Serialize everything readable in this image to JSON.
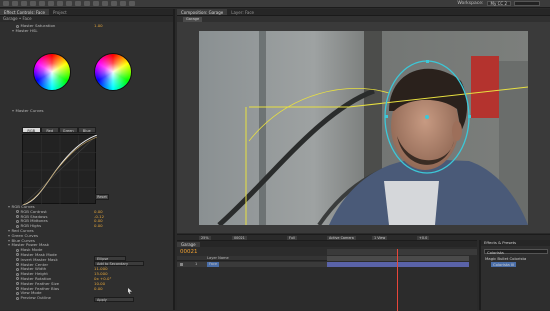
{
  "header": {
    "workspace_label": "Workspace:",
    "workspace_value": "My CC 2"
  },
  "left_panel": {
    "tabs": [
      "Effect Controls: Face",
      "Project"
    ],
    "subheader": "Garage • Face",
    "rows_top": [
      {
        "name": "Master Saturation",
        "value": "1.00"
      },
      {
        "name": "Master HSL",
        "value": ""
      }
    ],
    "master_curves_label": "Master Curves",
    "curve_tabs": [
      "RGB",
      "Red",
      "Green",
      "Blue"
    ],
    "reset_label": "Reset",
    "rows_bottom": [
      {
        "name": "RGB Curves",
        "value": "",
        "indent": 0
      },
      {
        "name": "RGB Contrast",
        "value": "0.00",
        "indent": 1
      },
      {
        "name": "RGB Shadows",
        "value": "-0.12",
        "indent": 1
      },
      {
        "name": "RGB Midtones",
        "value": "0.00",
        "indent": 1
      },
      {
        "name": "RGB Highs",
        "value": "0.00",
        "indent": 1
      },
      {
        "name": "Red Curves",
        "value": "",
        "indent": 0
      },
      {
        "name": "Green Curves",
        "value": "",
        "indent": 0
      },
      {
        "name": "Blue Curves",
        "value": "",
        "indent": 0
      },
      {
        "name": "Master Power Mask",
        "value": "",
        "indent": 0
      },
      {
        "name": "Mask Mode",
        "value": "",
        "indent": 1
      },
      {
        "name": "Master Mask Mode",
        "value": "",
        "indent": 1
      },
      {
        "name": "Invert Master Mask",
        "value": "",
        "indent": 1
      },
      {
        "name": "Master Center",
        "value": "300.0, 211.0",
        "indent": 1
      },
      {
        "name": "Master Width",
        "value": "11.000",
        "indent": 1
      },
      {
        "name": "Master Height",
        "value": "15.000",
        "indent": 1
      },
      {
        "name": "Master Rotation",
        "value": "0x +0.0°",
        "indent": 1
      },
      {
        "name": "Master Feather Size",
        "value": "10.00",
        "indent": 1
      },
      {
        "name": "Master Feather Bias",
        "value": "0.00",
        "indent": 1
      },
      {
        "name": "View Mode",
        "value": "",
        "indent": 1
      },
      {
        "name": "Preview Outline",
        "value": "",
        "indent": 1
      }
    ],
    "dropdowns": {
      "mask_mode": "Ellipse",
      "master_mask_mode": "Add to Secondary",
      "view_mode": "Apply"
    }
  },
  "composition": {
    "tabs": [
      "Composition: Garage",
      "Layer: Face"
    ],
    "chip": "Garage",
    "viewer_bar": {
      "zoom": "25%",
      "timecode": "00021",
      "resolution": "Full",
      "camera": "Active Camera",
      "views": "1 View",
      "exposure": "+0.0"
    }
  },
  "timeline": {
    "tab": "Garage",
    "timecode": "00021",
    "columns": [
      "Layer Name"
    ],
    "layers": [
      {
        "number": "1",
        "name": "Face"
      }
    ]
  },
  "effects_panel": {
    "title": "Effects & Presets",
    "items": [
      "Colorista",
      "Magic Bullet Colorista",
      "Colorista III"
    ]
  },
  "colors": {
    "accent_value": "#e0a33a",
    "track": "#5a63a8",
    "playhead": "#e8463a",
    "mask_outline": "#3cc8d8",
    "guide_line": "#e8e040"
  }
}
